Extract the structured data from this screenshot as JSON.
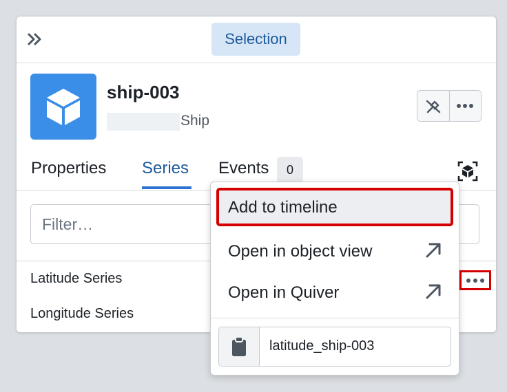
{
  "toolbar": {
    "selection_label": "Selection",
    "collapse_icon": "double-chevron-right-icon"
  },
  "object": {
    "title": "ship-003",
    "type": "Ship",
    "icon": "cube-icon",
    "icon_color": "#3b8ee8"
  },
  "tabs": [
    {
      "label": "Properties",
      "active": false
    },
    {
      "label": "Series",
      "active": true
    },
    {
      "label": "Events",
      "active": false,
      "count": "0"
    }
  ],
  "filter": {
    "placeholder": "Filter…",
    "value": ""
  },
  "series": [
    {
      "label": "Latitude Series"
    },
    {
      "label": "Longitude Series"
    }
  ],
  "menu": {
    "items": [
      {
        "label": "Add to timeline",
        "highlighted": true
      },
      {
        "label": "Open in object view",
        "icon": "arrow-up-right-icon"
      },
      {
        "label": "Open in Quiver",
        "icon": "arrow-up-right-icon"
      }
    ],
    "copy_value": "latitude_ship-003",
    "copy_icon": "clipboard-icon"
  },
  "colors": {
    "accent": "#2d72d2",
    "highlight_border": "#d40000",
    "selection_bg": "#d7e6f6"
  }
}
